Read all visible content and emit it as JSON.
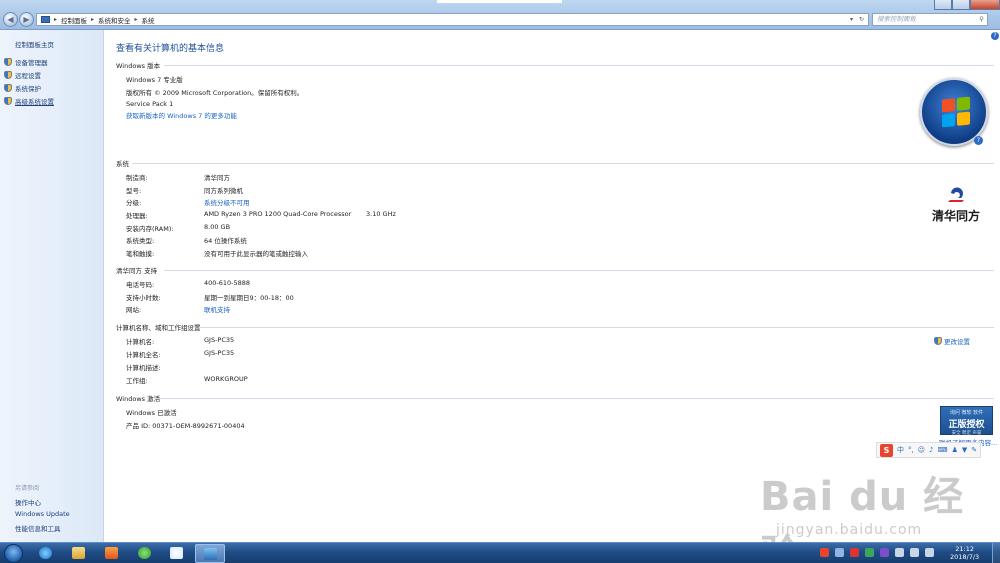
{
  "address_bar": {
    "crumbs": [
      "控制面板",
      "系统和安全",
      "系统"
    ],
    "search_placeholder": "搜索控制面板"
  },
  "left_pane": {
    "home": "控制面板主页",
    "items": [
      "设备管理器",
      "远程设置",
      "系统保护",
      "高级系统设置"
    ],
    "see_also_label": "另请参阅",
    "see_also": [
      "操作中心",
      "Windows Update",
      "性能信息和工具"
    ]
  },
  "main": {
    "title": "查看有关计算机的基本信息",
    "edition": {
      "header": "Windows 版本",
      "name": "Windows 7 专业版",
      "copyright": "版权所有 © 2009 Microsoft Corporation。保留所有权利。",
      "service_pack": "Service Pack 1",
      "more_features": "获取新版本的 Windows 7 的更多功能"
    },
    "system": {
      "header": "系统",
      "rows": [
        {
          "label": "制造商:",
          "value": "清华同方"
        },
        {
          "label": "型号:",
          "value": "同方系列微机"
        },
        {
          "label": "分级:",
          "value": "系统分级不可用"
        },
        {
          "label": "处理器:",
          "value": "AMD Ryzen 3 PRO 1200 Quad-Core Processor",
          "extra": "3.10 GHz"
        },
        {
          "label": "安装内存(RAM):",
          "value": "8.00 GB"
        },
        {
          "label": "系统类型:",
          "value": "64 位操作系统"
        },
        {
          "label": "笔和触摸:",
          "value": "没有可用于此显示器的笔或触控输入"
        }
      ],
      "oem_name": "清华同方"
    },
    "support": {
      "header": "清华同方 支持",
      "rows": [
        {
          "label": "电话号码:",
          "value": "400-610-5888"
        },
        {
          "label": "支持小时数:",
          "value": "星期一到星期日9：00-18：00"
        },
        {
          "label": "网站:",
          "value": "联机支持"
        }
      ]
    },
    "computer": {
      "header": "计算机名称、域和工作组设置",
      "rows": [
        {
          "label": "计算机名:",
          "value": "GJS-PC35"
        },
        {
          "label": "计算机全名:",
          "value": "GJS-PC35"
        },
        {
          "label": "计算机描述:",
          "value": ""
        },
        {
          "label": "工作组:",
          "value": "WORKGROUP"
        }
      ],
      "change_settings": "更改设置"
    },
    "activation": {
      "header": "Windows 激活",
      "status": "Windows 已激活",
      "product_id": "产品 ID: 00371-OEM-8992671-00404",
      "genuine_top": "询问 微软 软件",
      "genuine_main": "正版授权",
      "genuine_sub": "安全 稳定 声誉",
      "genuine_link": "联机了解更多内容..."
    }
  },
  "ime_bar": {
    "items": [
      "中",
      "°,"
    ]
  },
  "watermark": {
    "main": "Bai du 经验",
    "sub": "jingyan.baidu.com"
  },
  "taskbar": {
    "time": "21:12",
    "date": "2018/7/3"
  },
  "colors": {
    "link": "#1a63c4",
    "title": "#1f4f9c",
    "taskbar": "#1f4c86"
  }
}
